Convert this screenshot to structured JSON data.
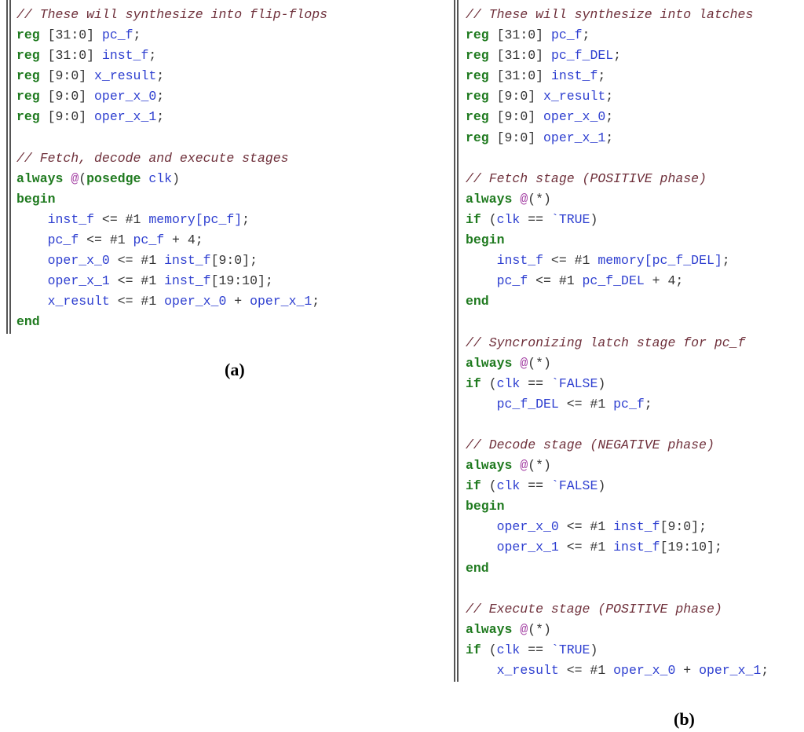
{
  "panel_a": {
    "caption": "(a)",
    "lines": [
      [
        {
          "t": "comment",
          "s": "// These will synthesize into flip-flops"
        }
      ],
      [
        {
          "t": "keyword",
          "s": "reg"
        },
        {
          "t": "punct",
          "s": " [31:0] "
        },
        {
          "t": "ident",
          "s": "pc_f"
        },
        {
          "t": "punct",
          "s": ";"
        }
      ],
      [
        {
          "t": "keyword",
          "s": "reg"
        },
        {
          "t": "punct",
          "s": " [31:0] "
        },
        {
          "t": "ident",
          "s": "inst_f"
        },
        {
          "t": "punct",
          "s": ";"
        }
      ],
      [
        {
          "t": "keyword",
          "s": "reg"
        },
        {
          "t": "punct",
          "s": " [9:0] "
        },
        {
          "t": "ident",
          "s": "x_result"
        },
        {
          "t": "punct",
          "s": ";"
        }
      ],
      [
        {
          "t": "keyword",
          "s": "reg"
        },
        {
          "t": "punct",
          "s": " [9:0] "
        },
        {
          "t": "ident",
          "s": "oper_x_0"
        },
        {
          "t": "punct",
          "s": ";"
        }
      ],
      [
        {
          "t": "keyword",
          "s": "reg"
        },
        {
          "t": "punct",
          "s": " [9:0] "
        },
        {
          "t": "ident",
          "s": "oper_x_1"
        },
        {
          "t": "punct",
          "s": ";"
        }
      ],
      [],
      [
        {
          "t": "comment",
          "s": "// Fetch, decode and execute stages"
        }
      ],
      [
        {
          "t": "keyword",
          "s": "always"
        },
        {
          "t": "punct",
          "s": " "
        },
        {
          "t": "at",
          "s": "@"
        },
        {
          "t": "punct",
          "s": "("
        },
        {
          "t": "keyword",
          "s": "posedge"
        },
        {
          "t": "punct",
          "s": " "
        },
        {
          "t": "ident",
          "s": "clk"
        },
        {
          "t": "punct",
          "s": ")"
        }
      ],
      [
        {
          "t": "keyword",
          "s": "begin"
        }
      ],
      [
        {
          "t": "punct",
          "s": "    "
        },
        {
          "t": "ident",
          "s": "inst_f"
        },
        {
          "t": "punct",
          "s": " <= #1 "
        },
        {
          "t": "ident",
          "s": "memory[pc_f]"
        },
        {
          "t": "punct",
          "s": ";"
        }
      ],
      [
        {
          "t": "punct",
          "s": "    "
        },
        {
          "t": "ident",
          "s": "pc_f"
        },
        {
          "t": "punct",
          "s": " <= #1 "
        },
        {
          "t": "ident",
          "s": "pc_f"
        },
        {
          "t": "punct",
          "s": " + 4;"
        }
      ],
      [
        {
          "t": "punct",
          "s": "    "
        },
        {
          "t": "ident",
          "s": "oper_x_0"
        },
        {
          "t": "punct",
          "s": " <= #1 "
        },
        {
          "t": "ident",
          "s": "inst_f"
        },
        {
          "t": "punct",
          "s": "[9:0];"
        }
      ],
      [
        {
          "t": "punct",
          "s": "    "
        },
        {
          "t": "ident",
          "s": "oper_x_1"
        },
        {
          "t": "punct",
          "s": " <= #1 "
        },
        {
          "t": "ident",
          "s": "inst_f"
        },
        {
          "t": "punct",
          "s": "[19:10];"
        }
      ],
      [
        {
          "t": "punct",
          "s": "    "
        },
        {
          "t": "ident",
          "s": "x_result"
        },
        {
          "t": "punct",
          "s": " <= #1 "
        },
        {
          "t": "ident",
          "s": "oper_x_0"
        },
        {
          "t": "punct",
          "s": " + "
        },
        {
          "t": "ident",
          "s": "oper_x_1"
        },
        {
          "t": "punct",
          "s": ";"
        }
      ],
      [
        {
          "t": "keyword",
          "s": "end"
        }
      ]
    ]
  },
  "panel_b": {
    "caption": "(b)",
    "lines": [
      [
        {
          "t": "comment",
          "s": "// These will synthesize into latches"
        }
      ],
      [
        {
          "t": "keyword",
          "s": "reg"
        },
        {
          "t": "punct",
          "s": " [31:0] "
        },
        {
          "t": "ident",
          "s": "pc_f"
        },
        {
          "t": "punct",
          "s": ";"
        }
      ],
      [
        {
          "t": "keyword",
          "s": "reg"
        },
        {
          "t": "punct",
          "s": " [31:0] "
        },
        {
          "t": "ident",
          "s": "pc_f_DEL"
        },
        {
          "t": "punct",
          "s": ";"
        }
      ],
      [
        {
          "t": "keyword",
          "s": "reg"
        },
        {
          "t": "punct",
          "s": " [31:0] "
        },
        {
          "t": "ident",
          "s": "inst_f"
        },
        {
          "t": "punct",
          "s": ";"
        }
      ],
      [
        {
          "t": "keyword",
          "s": "reg"
        },
        {
          "t": "punct",
          "s": " [9:0] "
        },
        {
          "t": "ident",
          "s": "x_result"
        },
        {
          "t": "punct",
          "s": ";"
        }
      ],
      [
        {
          "t": "keyword",
          "s": "reg"
        },
        {
          "t": "punct",
          "s": " [9:0] "
        },
        {
          "t": "ident",
          "s": "oper_x_0"
        },
        {
          "t": "punct",
          "s": ";"
        }
      ],
      [
        {
          "t": "keyword",
          "s": "reg"
        },
        {
          "t": "punct",
          "s": " [9:0] "
        },
        {
          "t": "ident",
          "s": "oper_x_1"
        },
        {
          "t": "punct",
          "s": ";"
        }
      ],
      [],
      [
        {
          "t": "comment",
          "s": "// Fetch stage (POSITIVE phase)"
        }
      ],
      [
        {
          "t": "keyword",
          "s": "always"
        },
        {
          "t": "punct",
          "s": " "
        },
        {
          "t": "at",
          "s": "@"
        },
        {
          "t": "punct",
          "s": "(*)"
        }
      ],
      [
        {
          "t": "keyword",
          "s": "if"
        },
        {
          "t": "punct",
          "s": " ("
        },
        {
          "t": "ident",
          "s": "clk"
        },
        {
          "t": "punct",
          "s": " == "
        },
        {
          "t": "ident",
          "s": "`TRUE"
        },
        {
          "t": "punct",
          "s": ")"
        }
      ],
      [
        {
          "t": "keyword",
          "s": "begin"
        }
      ],
      [
        {
          "t": "punct",
          "s": "    "
        },
        {
          "t": "ident",
          "s": "inst_f"
        },
        {
          "t": "punct",
          "s": " <= #1 "
        },
        {
          "t": "ident",
          "s": "memory[pc_f_DEL]"
        },
        {
          "t": "punct",
          "s": ";"
        }
      ],
      [
        {
          "t": "punct",
          "s": "    "
        },
        {
          "t": "ident",
          "s": "pc_f"
        },
        {
          "t": "punct",
          "s": " <= #1 "
        },
        {
          "t": "ident",
          "s": "pc_f_DEL"
        },
        {
          "t": "punct",
          "s": " + 4;"
        }
      ],
      [
        {
          "t": "keyword",
          "s": "end"
        }
      ],
      [],
      [
        {
          "t": "comment",
          "s": "// Syncronizing latch stage for pc_f"
        }
      ],
      [
        {
          "t": "keyword",
          "s": "always"
        },
        {
          "t": "punct",
          "s": " "
        },
        {
          "t": "at",
          "s": "@"
        },
        {
          "t": "punct",
          "s": "(*)"
        }
      ],
      [
        {
          "t": "keyword",
          "s": "if"
        },
        {
          "t": "punct",
          "s": " ("
        },
        {
          "t": "ident",
          "s": "clk"
        },
        {
          "t": "punct",
          "s": " == "
        },
        {
          "t": "ident",
          "s": "`FALSE"
        },
        {
          "t": "punct",
          "s": ")"
        }
      ],
      [
        {
          "t": "punct",
          "s": "    "
        },
        {
          "t": "ident",
          "s": "pc_f_DEL"
        },
        {
          "t": "punct",
          "s": " <= #1 "
        },
        {
          "t": "ident",
          "s": "pc_f"
        },
        {
          "t": "punct",
          "s": ";"
        }
      ],
      [],
      [
        {
          "t": "comment",
          "s": "// Decode stage (NEGATIVE phase)"
        }
      ],
      [
        {
          "t": "keyword",
          "s": "always"
        },
        {
          "t": "punct",
          "s": " "
        },
        {
          "t": "at",
          "s": "@"
        },
        {
          "t": "punct",
          "s": "(*)"
        }
      ],
      [
        {
          "t": "keyword",
          "s": "if"
        },
        {
          "t": "punct",
          "s": " ("
        },
        {
          "t": "ident",
          "s": "clk"
        },
        {
          "t": "punct",
          "s": " == "
        },
        {
          "t": "ident",
          "s": "`FALSE"
        },
        {
          "t": "punct",
          "s": ")"
        }
      ],
      [
        {
          "t": "keyword",
          "s": "begin"
        }
      ],
      [
        {
          "t": "punct",
          "s": "    "
        },
        {
          "t": "ident",
          "s": "oper_x_0"
        },
        {
          "t": "punct",
          "s": " <= #1 "
        },
        {
          "t": "ident",
          "s": "inst_f"
        },
        {
          "t": "punct",
          "s": "[9:0];"
        }
      ],
      [
        {
          "t": "punct",
          "s": "    "
        },
        {
          "t": "ident",
          "s": "oper_x_1"
        },
        {
          "t": "punct",
          "s": " <= #1 "
        },
        {
          "t": "ident",
          "s": "inst_f"
        },
        {
          "t": "punct",
          "s": "[19:10];"
        }
      ],
      [
        {
          "t": "keyword",
          "s": "end"
        }
      ],
      [],
      [
        {
          "t": "comment",
          "s": "// Execute stage (POSITIVE phase)"
        }
      ],
      [
        {
          "t": "keyword",
          "s": "always"
        },
        {
          "t": "punct",
          "s": " "
        },
        {
          "t": "at",
          "s": "@"
        },
        {
          "t": "punct",
          "s": "(*)"
        }
      ],
      [
        {
          "t": "keyword",
          "s": "if"
        },
        {
          "t": "punct",
          "s": " ("
        },
        {
          "t": "ident",
          "s": "clk"
        },
        {
          "t": "punct",
          "s": " == "
        },
        {
          "t": "ident",
          "s": "`TRUE"
        },
        {
          "t": "punct",
          "s": ")"
        }
      ],
      [
        {
          "t": "punct",
          "s": "    "
        },
        {
          "t": "ident",
          "s": "x_result"
        },
        {
          "t": "punct",
          "s": " <= #1 "
        },
        {
          "t": "ident",
          "s": "oper_x_0"
        },
        {
          "t": "punct",
          "s": " + "
        },
        {
          "t": "ident",
          "s": "oper_x_1"
        },
        {
          "t": "punct",
          "s": ";"
        }
      ]
    ]
  },
  "colors": {
    "comment": "#6e2f3a",
    "keyword": "#1f7a1f",
    "identifier": "#2e3fd0",
    "punctuation": "#333333",
    "at_symbol": "#a33fa3"
  }
}
